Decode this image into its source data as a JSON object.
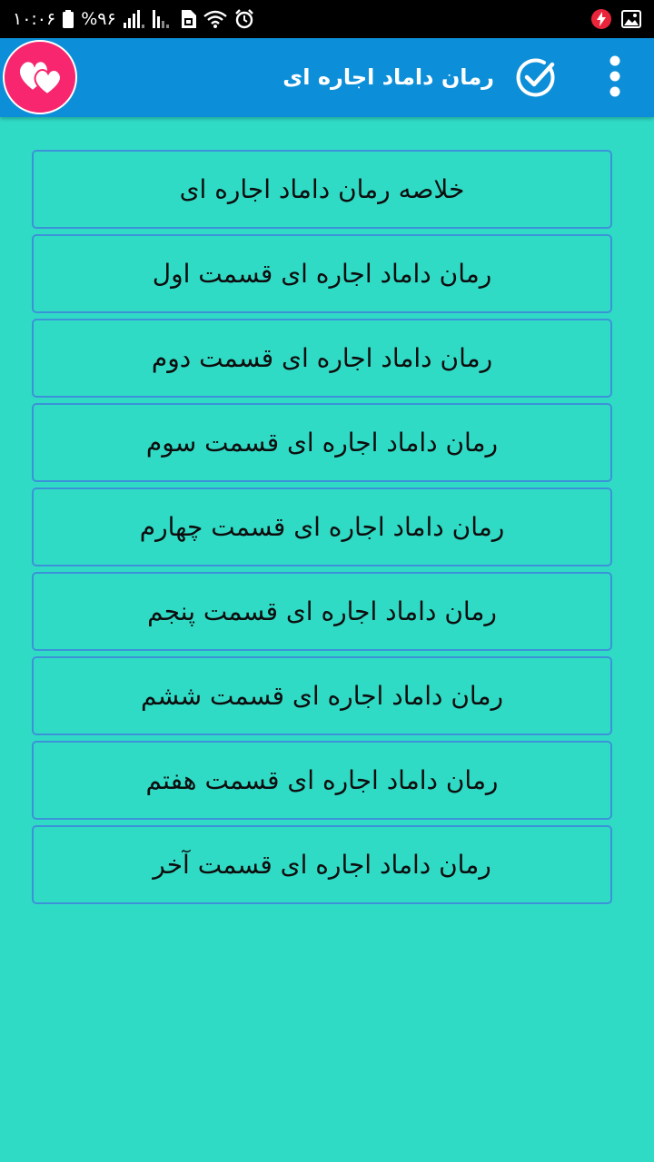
{
  "status_bar": {
    "time": "۱۰:۰۶",
    "battery": "%۹۶",
    "icons": [
      "battery-icon",
      "signal-icon",
      "signal-icon",
      "sim-icon",
      "wifi-icon",
      "alarm-icon",
      "flash-icon",
      "image-icon"
    ]
  },
  "app_bar": {
    "title": "رمان داماد اجاره ای",
    "left_icon": "hearts-icon",
    "check_icon": "check-circle-icon",
    "menu_icon": "more-vert-icon"
  },
  "chapters": [
    {
      "label": "خلاصه رمان داماد اجاره ای"
    },
    {
      "label": "رمان داماد اجاره ای قسمت اول"
    },
    {
      "label": "رمان داماد اجاره ای قسمت دوم"
    },
    {
      "label": "رمان داماد اجاره ای قسمت سوم"
    },
    {
      "label": "رمان داماد اجاره ای قسمت چهارم"
    },
    {
      "label": "رمان داماد اجاره ای قسمت پنجم"
    },
    {
      "label": "رمان داماد اجاره ای قسمت ششم"
    },
    {
      "label": "رمان داماد اجاره ای قسمت هفتم"
    },
    {
      "label": "رمان داماد اجاره ای قسمت آخر"
    }
  ],
  "colors": {
    "background": "#30dbc6",
    "app_bar": "#0c8fd8",
    "accent": "#f7266e",
    "item_border": "#3c92d8"
  }
}
